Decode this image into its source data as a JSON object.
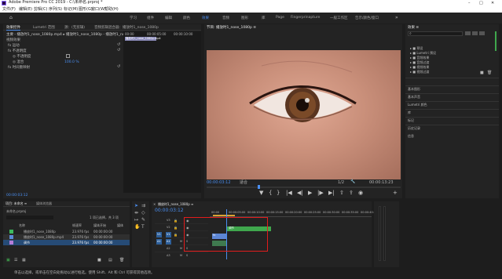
{
  "app": {
    "title": "Adobe Premiere Pro CC 2019 - C:\\未命名.prproj *",
    "menu": [
      "文件(F)",
      "编辑(E)",
      "剪辑(C)",
      "序列(S)",
      "标记(M)",
      "图形(G)",
      "窗口(W)",
      "帮助(H)"
    ],
    "workspaces": [
      "学习",
      "组件",
      "编辑",
      "颜色",
      "效果",
      "音频",
      "图形",
      "库",
      "Page",
      "Fingerprinapture",
      "一般工作区",
      "告示/颜色/窗口"
    ],
    "active_workspace": "效果",
    "window_controls": [
      "–",
      "□",
      "✕"
    ]
  },
  "source_panel": {
    "tabs": [
      "效果控件",
      "Lumetri 范围",
      "源：(无剪辑)",
      "音频剪辑混合器：播放时1_nose_1080p"
    ],
    "clip_path": "主要 - 播放时1_nose_1080p.mp4 ▸ 播放时1_nose_1080p - 播放时1_nose_1080p...",
    "section_video": "视频效果",
    "effects": [
      "fx 运动",
      "fx 不透明度",
      "fx 时间重映射"
    ],
    "sub_opacity": [
      "◎ 不透明度",
      "◎ 混合"
    ],
    "values": [
      "",
      "100.0 %",
      ""
    ],
    "ruler_times": [
      "00:00",
      "00:00:05:00",
      "00:00:10:00"
    ],
    "clip_label": "播放时1_nose_1080p.mp4",
    "bottom_time": "00:00:03:12"
  },
  "program_monitor": {
    "title": "节目: 播放时1_nose_1080p ≡",
    "timecode": "00:00:03:12",
    "fit": "适合",
    "quality": "1/2",
    "duration": "00:00:13:23"
  },
  "project_panel": {
    "tabs": [
      "项目: 未命名 ≡",
      "媒体浏览器",
      "库",
      "信息"
    ],
    "file": "未命名.prproj",
    "count": "1 项已选择，共 3 项",
    "columns": [
      "名称",
      "帧速率",
      "媒体开始",
      "媒体"
    ],
    "items": [
      {
        "name": "播放时1_nose_1080p",
        "fps": "23.976 fps",
        "start": "00:00:00:00",
        "color": "#3dbb5e"
      },
      {
        "name": "播放时1_nose_1080p.mp4",
        "fps": "23.976 fps",
        "start": "00:00:00:00",
        "color": "#5b8ad8"
      },
      {
        "name": "调节",
        "fps": "23.976 fps",
        "start": "00:00:00:00",
        "color": "#b47cd8"
      }
    ]
  },
  "timeline": {
    "tab": "播放时1_nose_1080p ≡",
    "timecode": "00:00:03:12",
    "ruler": [
      "00:00",
      "00:00:05:00",
      "00:00:10:00",
      "00:00:15:00",
      "00:00:20:00",
      "00:00:25:00",
      "00:00:30:00",
      "00:00:35:00",
      "00:00:40:00"
    ],
    "tracks": [
      "V3",
      "V2",
      "V1",
      "A1",
      "A2",
      "A3"
    ],
    "clips": {
      "adjust": "调节",
      "video": "fx"
    }
  },
  "effects_panel": {
    "title": "效果 ≡",
    "search_placeholder": "",
    "folders": [
      "预设",
      "Lumetri 预设",
      "音频效果",
      "音频过渡",
      "视频效果",
      "视频过渡"
    ],
    "sections": [
      "基本图形",
      "基本声音",
      "Lumetri 颜色",
      "库",
      "标记",
      "历史记录",
      "信息"
    ]
  },
  "status_bar": {
    "text": "单击以选择，或单击在空白处拖动以进行框选。使用 Shift、Alt 和 Ctrl 可获得其他选项。"
  },
  "colors": {
    "accent": "#2d8ceb",
    "clip_green": "#3fa74d",
    "clip_blue": "#5d86d4",
    "selection_red": "#e21c1c",
    "timecode": "#4a8ef0"
  }
}
